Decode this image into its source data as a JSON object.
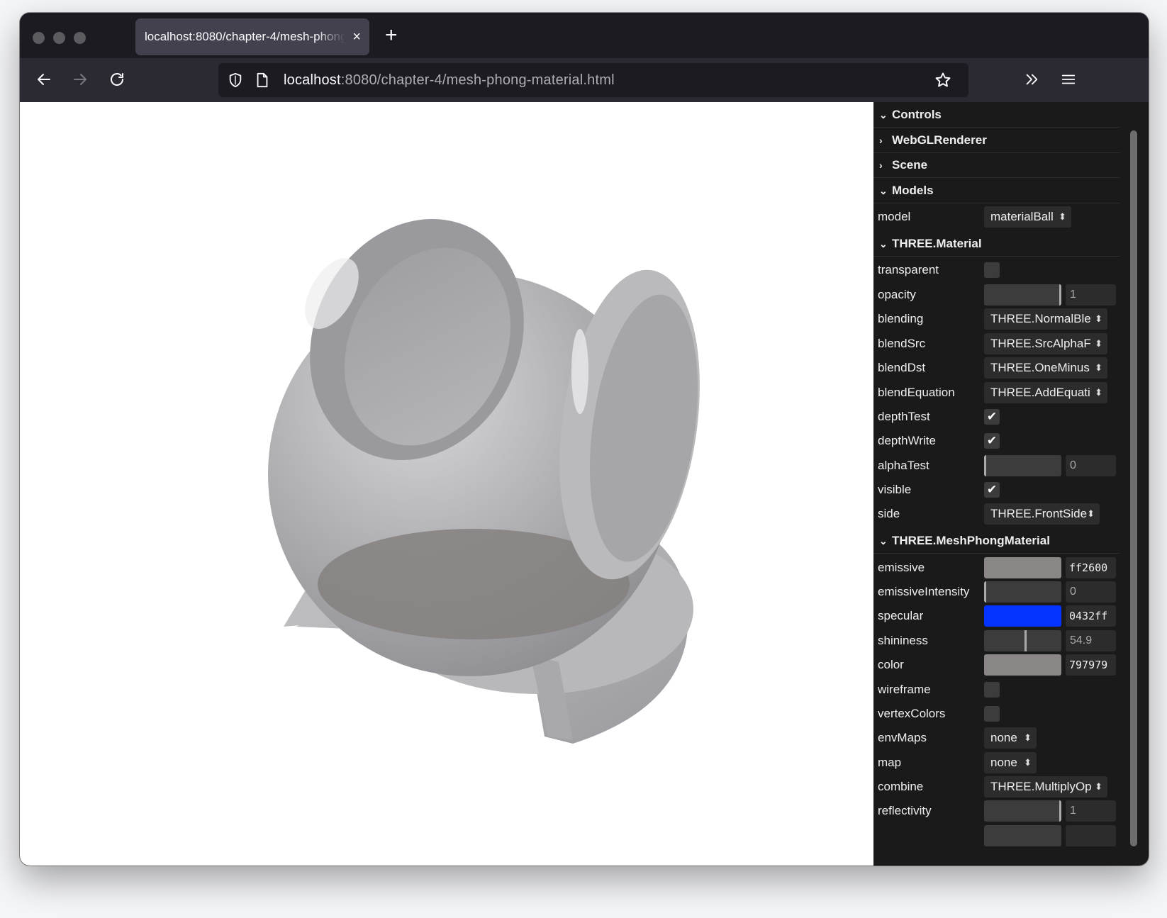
{
  "browser": {
    "tab_title": "localhost:8080/chapter-4/mesh-phong-material.html",
    "tab_close": "×",
    "new_tab": "+",
    "url_host": "localhost",
    "url_rest": ":8080/chapter-4/mesh-phong-material.html"
  },
  "panel": {
    "folders": {
      "controls": "Controls",
      "webgl": "WebGLRenderer",
      "scene": "Scene",
      "models": "Models",
      "material": "THREE.Material",
      "phong": "THREE.MeshPhongMaterial"
    },
    "models": {
      "model_label": "model",
      "model_value": "materialBall"
    },
    "material": {
      "transparent": {
        "label": "transparent",
        "checked": false
      },
      "opacity": {
        "label": "opacity",
        "value": "1",
        "fraction": 1
      },
      "blending": {
        "label": "blending",
        "value": "THREE.NormalBle"
      },
      "blendSrc": {
        "label": "blendSrc",
        "value": "THREE.SrcAlphaF"
      },
      "blendDst": {
        "label": "blendDst",
        "value": "THREE.OneMinus"
      },
      "blendEquation": {
        "label": "blendEquation",
        "value": "THREE.AddEquati"
      },
      "depthTest": {
        "label": "depthTest",
        "checked": true
      },
      "depthWrite": {
        "label": "depthWrite",
        "checked": true
      },
      "alphaTest": {
        "label": "alphaTest",
        "value": "0",
        "fraction": 0
      },
      "visible": {
        "label": "visible",
        "checked": true
      },
      "side": {
        "label": "side",
        "value": "THREE.FrontSide"
      }
    },
    "phong": {
      "emissive": {
        "label": "emissive",
        "value": "ff2600",
        "swatch": "#8a8686"
      },
      "emissiveIntensity": {
        "label": "emissiveIntensity",
        "value": "0",
        "fraction": 0
      },
      "specular": {
        "label": "specular",
        "value": "0432ff",
        "swatch": "#0432ff"
      },
      "shininess": {
        "label": "shininess",
        "value": "54.9",
        "fraction": 0.55
      },
      "color": {
        "label": "color",
        "value": "797979",
        "swatch": "#8a8686"
      },
      "wireframe": {
        "label": "wireframe",
        "checked": false
      },
      "vertexColors": {
        "label": "vertexColors",
        "checked": false
      },
      "envMaps": {
        "label": "envMaps",
        "value": "none"
      },
      "map": {
        "label": "map",
        "value": "none"
      },
      "combine": {
        "label": "combine",
        "value": "THREE.MultiplyOp"
      },
      "reflectivity": {
        "label": "reflectivity",
        "value": "1",
        "fraction": 1
      }
    }
  }
}
